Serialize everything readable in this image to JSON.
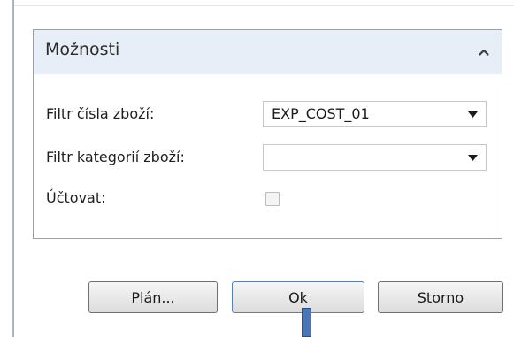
{
  "panel": {
    "title": "Možnosti",
    "collapse_icon": "chevron-up-icon"
  },
  "fields": {
    "item_filter": {
      "label": "Filtr čísla zboží:",
      "value": "EXP_COST_01"
    },
    "category_filter": {
      "label": "Filtr kategorií zboží:",
      "value": ""
    },
    "post": {
      "label": "Účtovat:",
      "checked": false
    }
  },
  "buttons": {
    "plan_label": "Plán...",
    "ok_label": "Ok",
    "cancel_label": "Storno"
  },
  "colors": {
    "panel_border": "#7ea6d8",
    "panel_header": "#e8eef7",
    "drag_marker": "#4a76b8"
  }
}
